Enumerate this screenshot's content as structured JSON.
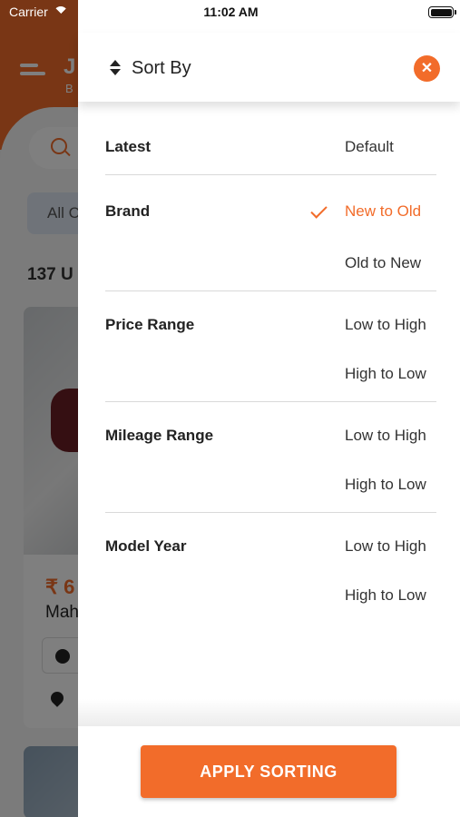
{
  "status_bar": {
    "carrier": "Carrier",
    "time": "11:02 AM"
  },
  "background": {
    "title": "J",
    "subtitle": "B",
    "filter_chip": "All C",
    "result_count": "137 U",
    "card_price": "₹ 6",
    "card_name": "Mah"
  },
  "drawer": {
    "title": "Sort By",
    "close_icon": "✕",
    "sections": [
      {
        "label": "Latest",
        "options": [
          "Default"
        ]
      },
      {
        "label": "Brand",
        "options": [
          "New to Old",
          "Old to New"
        ],
        "selected": "New to Old"
      },
      {
        "label": "Price Range",
        "options": [
          "Low to High",
          "High to Low"
        ]
      },
      {
        "label": "Mileage Range",
        "options": [
          "Low to High",
          "High to Low"
        ]
      },
      {
        "label": "Model Year",
        "options": [
          "Low to High",
          "High to Low"
        ]
      }
    ],
    "apply_label": "APPLY SORTING"
  },
  "colors": {
    "accent": "#f26c2a",
    "text": "#222222",
    "divider": "#d9d9d9"
  }
}
